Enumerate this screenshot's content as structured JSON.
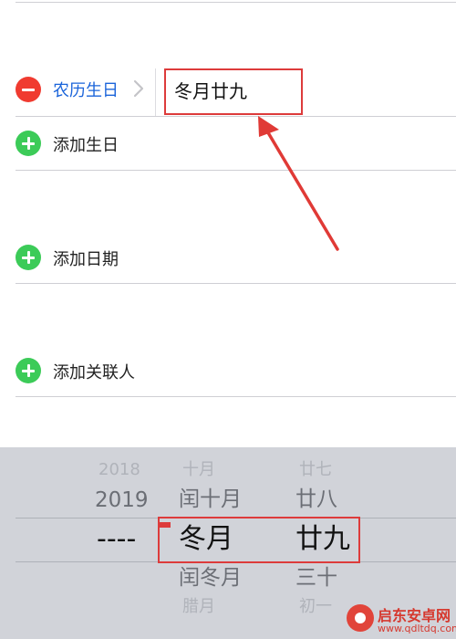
{
  "lunar_birthday": {
    "label": "农历生日",
    "value": "冬月廿九"
  },
  "add_rows": [
    {
      "label": "添加生日",
      "icon": "plus-circle-icon"
    },
    {
      "label": "添加日期",
      "icon": "plus-circle-icon"
    },
    {
      "label": "添加关联人",
      "icon": "plus-circle-icon"
    }
  ],
  "picker": {
    "year": {
      "above2": "2018",
      "above1": "2019",
      "selected": "----"
    },
    "month": {
      "above2": "十月",
      "above1": "闰十月",
      "selected": "冬月",
      "below1": "闰冬月",
      "below2": "腊月"
    },
    "day": {
      "above2": "廿七",
      "above1": "廿八",
      "selected": "廿九",
      "below1": "三十",
      "below2": "初一"
    }
  },
  "watermark": {
    "title": "启东安卓网",
    "url": "www.qdltdq.com"
  },
  "colors": {
    "remove": "#f03b30",
    "add": "#3ccb58",
    "link": "#1b64da",
    "highlight": "#dd3b3b",
    "picker_bg": "#d1d3d9"
  }
}
